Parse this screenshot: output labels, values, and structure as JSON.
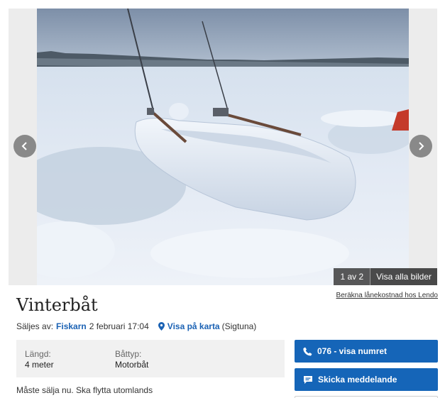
{
  "gallery": {
    "counter": "1 av 2",
    "show_all_label": "Visa alla bilder"
  },
  "listing": {
    "title": "Vinterbåt",
    "sold_by_label": "Säljes av:",
    "seller": "Fiskarn",
    "date": "2 februari 17:04",
    "map_link": "Visa på karta",
    "location": "(Sigtuna)",
    "loan_link": "Beräkna lånekostnad hos Lendo",
    "attributes": [
      {
        "label": "Längd:",
        "value": "4 meter"
      },
      {
        "label": "Båttyp:",
        "value": "Motorbåt"
      }
    ],
    "description": "Måste sälja nu. Ska flytta utomlands"
  },
  "actions": {
    "phone_label": "076 - visa numret",
    "message_label": "Skicka meddelande"
  },
  "icons": {
    "prev": "chevron-left-icon",
    "next": "chevron-right-icon",
    "pin": "map-pin-icon",
    "phone": "phone-icon",
    "message": "chat-bubble-icon"
  },
  "colors": {
    "accent": "#1565b8",
    "link": "#1b62b4"
  }
}
